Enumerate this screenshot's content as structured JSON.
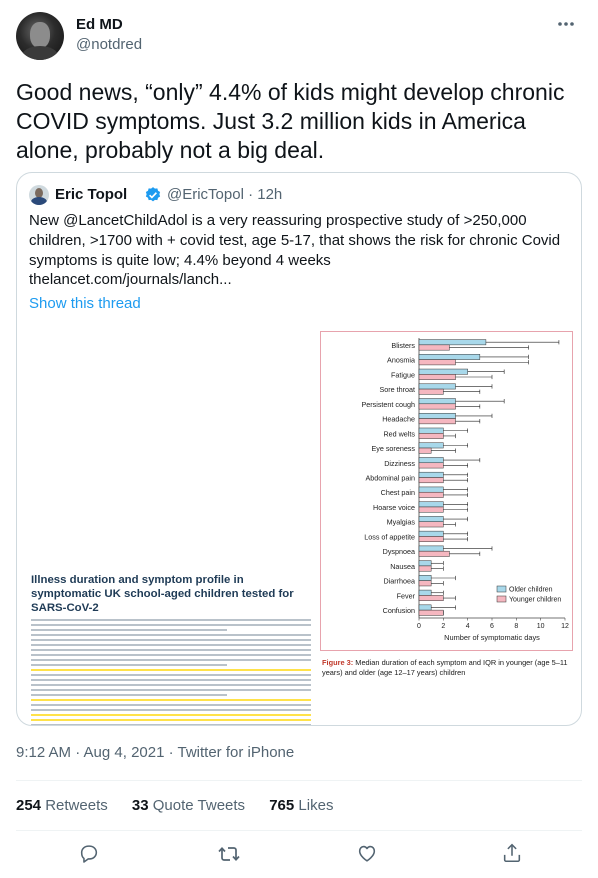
{
  "tweet": {
    "author_name": "Ed MD",
    "author_handle": "@notdred",
    "more_icon": "more-horizontal-icon",
    "text": "Good news, “only” 4.4% of kids might develop chronic COVID symptoms. Just 3.2 million kids in America alone, probably not a big deal.",
    "timestamp": "9:12 AM · Aug 4, 2021 · Twitter for iPhone",
    "retweets_count": "254",
    "retweets_label": "Retweets",
    "quote_tweets_count": "33",
    "quote_tweets_label": "Quote Tweets",
    "likes_count": "765",
    "likes_label": "Likes"
  },
  "quoted": {
    "author_name": "Eric Topol",
    "author_handle_time": "@EricTopol · 12h",
    "text": "New @LancetChildAdol is a very reassuring prospective  study of >250,000 children,  >1700 with + covid test, age  5-17, that shows the risk for chronic Covid symptoms is quite low; 4.4% beyond 4 weeks",
    "link": "thelancet.com/journals/lanch...",
    "show_thread": "Show this thread"
  },
  "article": {
    "title": "Illness duration and symptom profile in symptomatic UK school-aged children tested for SARS-CoV-2",
    "figure_caption_label": "Figure 3:",
    "figure_caption": "Median duration of each symptom and IQR in younger (age 5–11 years) and older (age 12–17 years) children"
  },
  "chart_data": {
    "type": "bar",
    "orientation": "horizontal",
    "categories": [
      "Blisters",
      "Anosmia",
      "Fatigue",
      "Sore throat",
      "Persistent cough",
      "Headache",
      "Red welts",
      "Eye soreness",
      "Dizziness",
      "Abdominal pain",
      "Chest pain",
      "Hoarse voice",
      "Myalgias",
      "Loss of appetite",
      "Dyspnoea",
      "Nausea",
      "Diarrhoea",
      "Fever",
      "Confusion"
    ],
    "series": [
      {
        "name": "Older children",
        "color": "#a8d8ea",
        "values": [
          5.5,
          5,
          4,
          3,
          3,
          3,
          2,
          2,
          2,
          2,
          2,
          2,
          2,
          2,
          2,
          1,
          1,
          1,
          1
        ],
        "err_high": [
          11.5,
          9,
          7,
          6,
          7,
          6,
          4,
          4,
          5,
          4,
          4,
          4,
          4,
          4,
          6,
          2,
          3,
          2,
          3
        ]
      },
      {
        "name": "Younger children",
        "color": "#f5b7c0",
        "values": [
          2.5,
          3,
          3,
          2,
          3,
          3,
          2,
          1,
          2,
          2,
          2,
          2,
          2,
          2,
          2.5,
          1,
          1,
          2,
          2
        ],
        "err_high": [
          9,
          9,
          6,
          5,
          5,
          5,
          3,
          3,
          4,
          4,
          4,
          4,
          3,
          4,
          5,
          2,
          2,
          3,
          2
        ]
      }
    ],
    "x_ticks": [
      "0",
      "2",
      "4",
      "6",
      "8",
      "10",
      "12"
    ],
    "xlim": [
      0,
      12
    ],
    "xlabel": "Number of symptomatic days",
    "legend_position": "bottom-right"
  },
  "icons": {
    "reply": "reply-icon",
    "retweet": "retweet-icon",
    "like": "like-icon",
    "share": "share-icon",
    "verified": "verified-badge-icon"
  }
}
